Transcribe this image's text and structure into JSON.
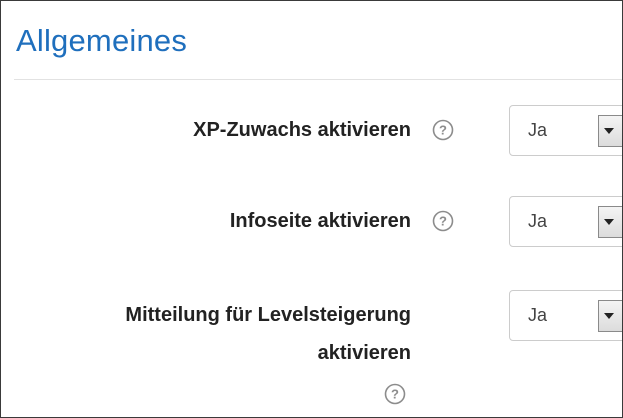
{
  "section": {
    "title": "Allgemeines"
  },
  "settings": [
    {
      "label": "XP-Zuwachs aktivieren",
      "value": "Ja",
      "help_icon": "question-circle-icon"
    },
    {
      "label": "Infoseite aktivieren",
      "value": "Ja",
      "help_icon": "question-circle-icon"
    },
    {
      "label_line1": "Mitteilung für Levelsteigerung",
      "label_line2": "aktivieren",
      "value": "Ja",
      "help_icon": "question-circle-icon"
    }
  ],
  "colors": {
    "title": "#1f6fbd",
    "label": "#222222",
    "border": "#cccccc"
  }
}
